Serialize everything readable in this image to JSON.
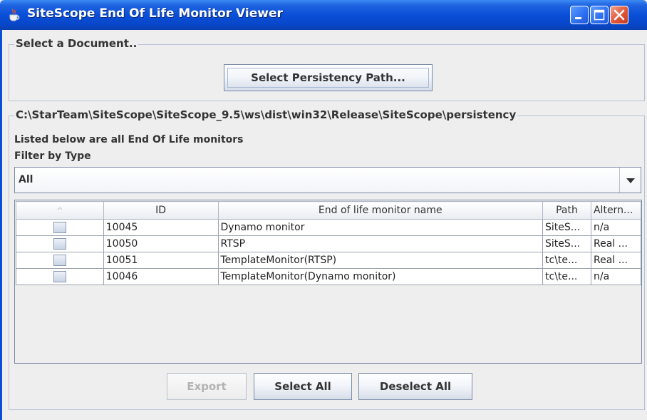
{
  "window": {
    "title": "SiteScope End Of Life Monitor Viewer"
  },
  "document_group": {
    "title": "Select a Document..",
    "select_path_button": "Select Persistency Path..."
  },
  "persistency_group": {
    "title": "C:\\StarTeam\\SiteScope\\SiteScope_9.5\\ws\\dist\\win32\\Release\\SiteScope\\persistency",
    "description": "Listed below are all End Of Life monitors",
    "filter_label": "Filter by Type",
    "filter_value": "All"
  },
  "table": {
    "sort_indicator": "^",
    "columns": [
      "ID",
      "End of life monitor name",
      "Path",
      "Altern..."
    ],
    "rows": [
      {
        "id": "10045",
        "name": "Dynamo monitor",
        "path": "SiteS...",
        "alternative": "n/a"
      },
      {
        "id": "10050",
        "name": "RTSP",
        "path": "SiteS...",
        "alternative": "Real ..."
      },
      {
        "id": "10051",
        "name": "TemplateMonitor(RTSP)",
        "path": "tc\\te...",
        "alternative": "Real ..."
      },
      {
        "id": "10046",
        "name": "TemplateMonitor(Dynamo monitor)",
        "path": "tc\\te...",
        "alternative": "n/a"
      }
    ]
  },
  "actions": {
    "export": "Export",
    "select_all": "Select All",
    "deselect_all": "Deselect All"
  },
  "colors": {
    "titlebar": "#0a4fd8",
    "close_button": "#e0563a",
    "window_bg": "#eeeeee"
  },
  "icons": [
    "java-cup-icon",
    "minimize-icon",
    "maximize-icon",
    "close-icon",
    "dropdown-arrow-icon"
  ]
}
